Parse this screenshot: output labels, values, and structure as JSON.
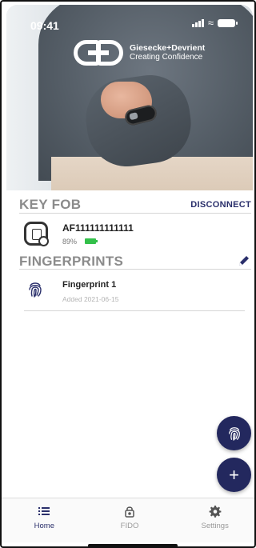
{
  "status_bar": {
    "time": "09:41"
  },
  "brand": {
    "name": "Giesecke+Devrient",
    "tagline": "Creating Confidence"
  },
  "key_fob": {
    "section_title": "KEY FOB",
    "disconnect_label": "DISCONNECT",
    "device_id": "AF111111111111",
    "battery_percent": "89%",
    "battery_level": 0.89
  },
  "fingerprints": {
    "section_title": "FINGERPRINTS",
    "items": [
      {
        "name": "Fingerprint 1",
        "added": "Added 2021-06-15"
      }
    ]
  },
  "tabs": [
    {
      "label": "Home",
      "icon": "list-icon",
      "active": true
    },
    {
      "label": "FIDO",
      "icon": "lock-icon",
      "active": false
    },
    {
      "label": "Settings",
      "icon": "gear-icon",
      "active": false
    }
  ],
  "colors": {
    "accent": "#23285e",
    "battery_green": "#33c04a",
    "section_title": "#8b8b8b"
  }
}
